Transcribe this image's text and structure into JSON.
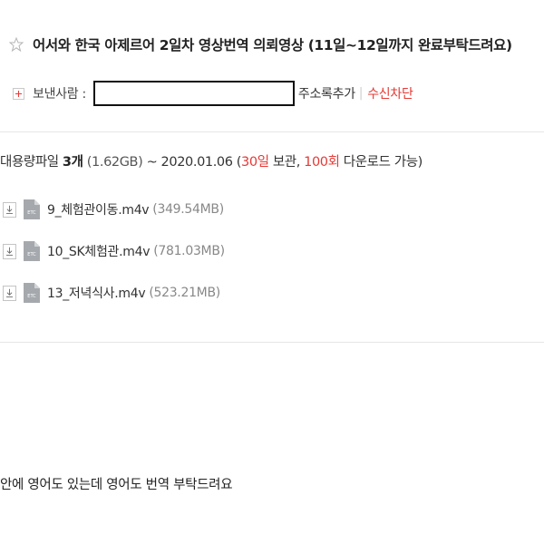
{
  "mail": {
    "subject": "어서와 한국 아제르어 2일차 영상번역 의뢰영상 (11일~12일까지 완료부탁드려요)",
    "sender_label": "보낸사람 :",
    "add_contact_label": "주소록추가",
    "separator": "|",
    "block_label": "수신차단"
  },
  "attachments": {
    "summary_prefix": "대용량파일",
    "summary_count": "3개",
    "total_size": "(1.62GB)",
    "expiry_text": "~ 2020.01.06 (",
    "keep_days": "30일",
    "keep_suffix": " 보관, ",
    "download_count": "100회",
    "download_suffix": " 다운로드 가능)",
    "files": [
      {
        "name": "9_체험관이동.m4v",
        "size": "(349.54MB)",
        "type_label": "ETC"
      },
      {
        "name": "10_SK체험관.m4v",
        "size": "(781.03MB)",
        "type_label": "ETC"
      },
      {
        "name": "13_저녁식사.m4v",
        "size": "(523.21MB)",
        "type_label": "ETC"
      }
    ]
  },
  "body": {
    "text": "안에 영어도 있는데 영어도 번역 부탁드려요"
  },
  "colors": {
    "accent_red": "#e53935",
    "muted_gray": "#888888",
    "icon_gray": "#a5a9ad"
  }
}
